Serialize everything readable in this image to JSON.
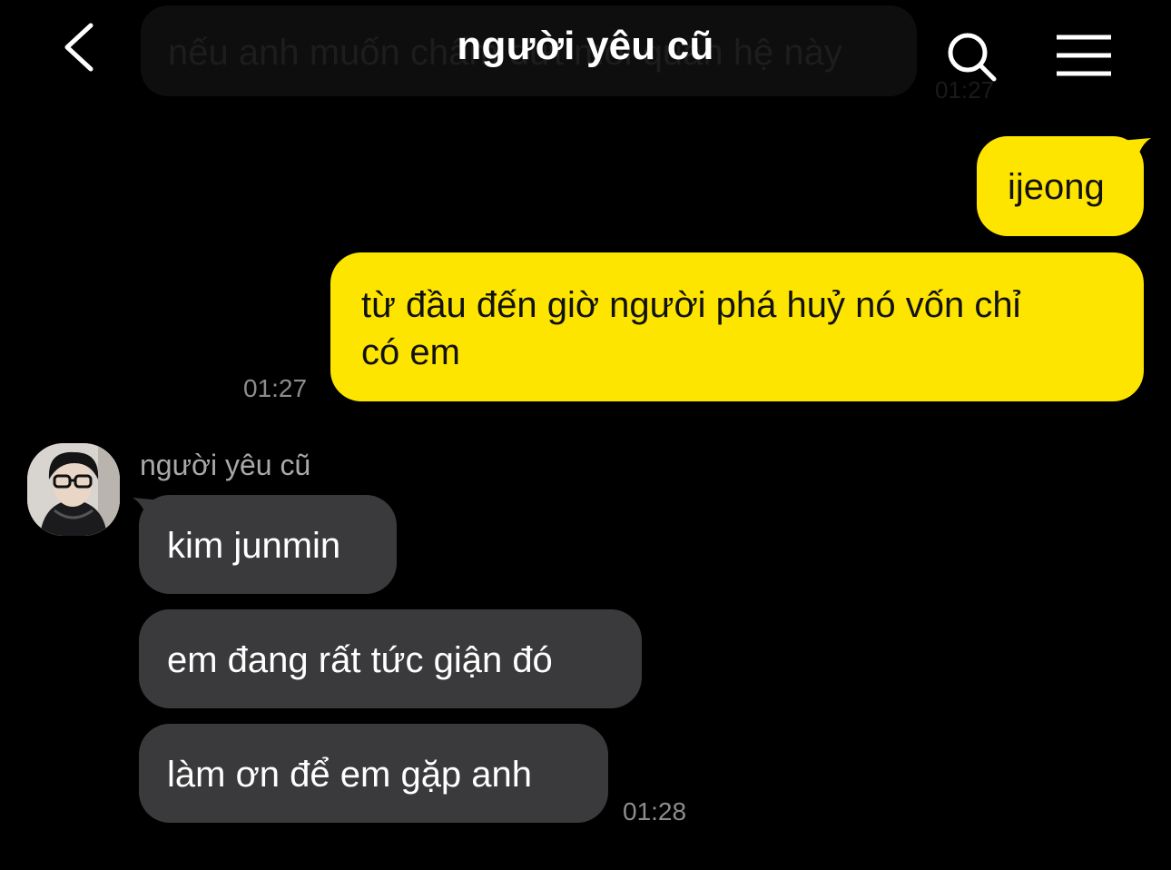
{
  "header": {
    "title": "người yêu cũ",
    "back_icon": "chevron-left-icon",
    "search_icon": "search-icon",
    "menu_icon": "hamburger-menu-icon"
  },
  "faded_message": {
    "text": "nếu anh muốn chấm dứt mối quan hệ này",
    "time": "01:27"
  },
  "messages": {
    "outgoing": [
      {
        "text": "ijeong"
      },
      {
        "text_line1": "từ đầu đến giờ người phá huỷ nó vốn chỉ",
        "text_line2": "có em",
        "time": "01:27"
      }
    ],
    "incoming_sender": "người yêu cũ",
    "incoming": [
      {
        "text": "kim junmin"
      },
      {
        "text": "em đang rất tức giận đó"
      },
      {
        "text": "làm ơn để em gặp anh",
        "time": "01:28"
      }
    ]
  },
  "colors": {
    "background": "#000000",
    "outgoing_bubble": "#fee500",
    "incoming_bubble": "#3a3a3c",
    "timestamp": "#8d8d8d"
  }
}
